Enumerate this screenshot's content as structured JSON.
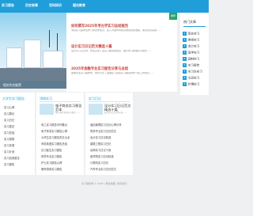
{
  "nav": {
    "items": [
      "实习报告",
      "历史故事",
      "百科知识",
      "理论教育"
    ]
  },
  "hero": {
    "panel_label": "相关作文推荐"
  },
  "main": {
    "badge": "推荐",
    "articles": [
      {
        "title": "如何撰写2025年考古学实习总结报告",
        "body": "考古实习是学生学习考古学知识，投入大量时间在实地调查和发掘，通过亲身实践……"
      },
      {
        "title": "设计实习日记范文精选十篇",
        "body": "设计实习日记中，学生记录了在实习期间的经历，展示学习的收获与成长……"
      },
      {
        "title": "2025年金融专业实习报告分享与总结",
        "body": "金融专业实习报告中，本文分享了金融实习生在实习期间的学习和工作经历……"
      }
    ]
  },
  "sidebar": {
    "heading": "热门文章",
    "items": [
      "职业实习",
      "教师实习",
      "会计实习",
      "医学实习",
      "园林实习",
      "实习报告",
      "实习生实习",
      "文员实习",
      "护理实习"
    ]
  },
  "left_card": {
    "title": "大学生实习报告",
    "lines": [
      "实习心得",
      "实习周记",
      "实习日记",
      "实习鉴定",
      "实习总结",
      "实习感想",
      "实习评语",
      "实习计划",
      "实习自我鉴定",
      "实习报告"
    ]
  },
  "columns": [
    {
      "heading": "顶岗实习",
      "feature_title": "电子商务实习报告范本",
      "feature_sub": "电子商务专业实习报告……",
      "links": [
        "电工实习报告写作要点",
        "电子商务实习报告心得",
        "大学生实习报告范文大全",
        "商务英语实习报告总结",
        "见习医生实习报告",
        "药学专业实习报告",
        "护士实习报告心得",
        "教师顶岗实习报告"
      ]
    },
    {
      "heading": "实习日记",
      "feature_title": "设计实习日记范文精选十篇",
      "feature_sub": "设计实习日记中记录……",
      "links": [
        "酒店管理实习日记心得分享",
        "财务专业实习日记范文",
        "会计实习日记精选",
        "建筑工程实习日记",
        "幼师实习日记十篇",
        "医学院实习日记精选",
        "计算机实习日记",
        "汽车专业实习日记范文"
      ]
    }
  ],
  "footer": {
    "text": "实习报告网 © 2025 | 网站地图 | 联系我们"
  }
}
